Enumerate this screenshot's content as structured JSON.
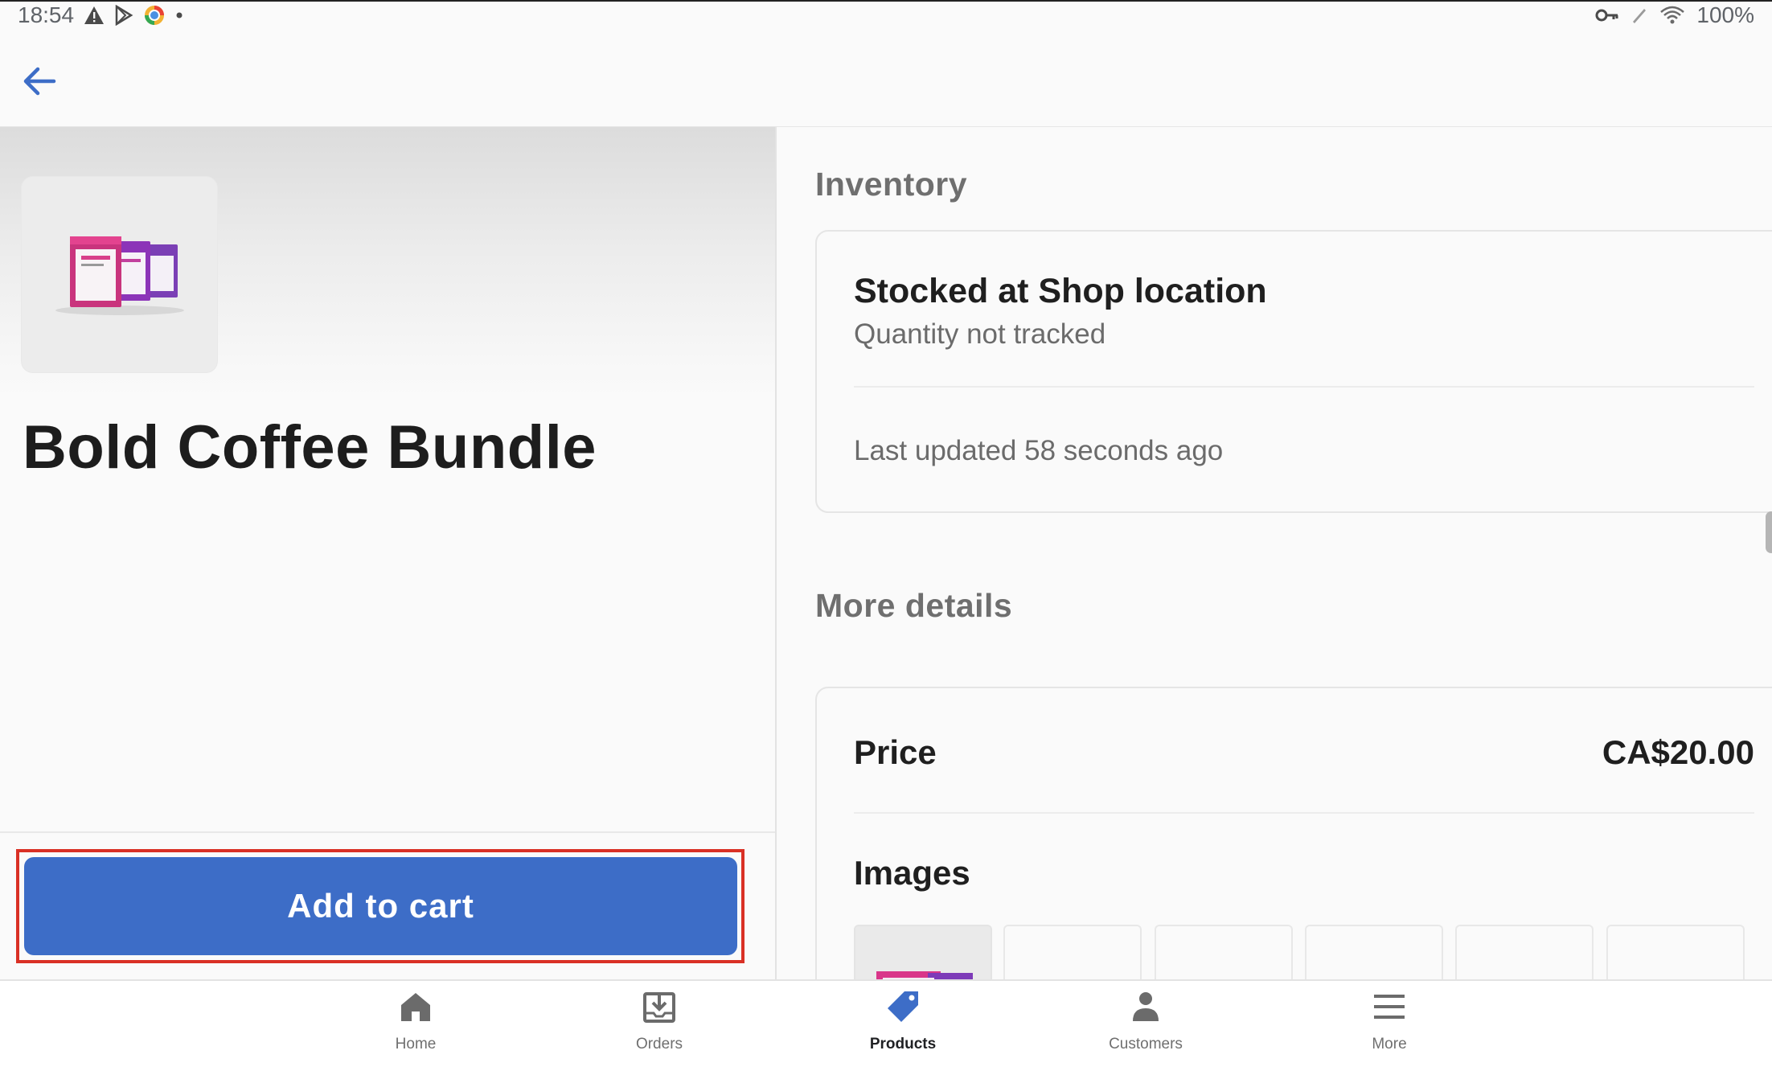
{
  "status_bar": {
    "time": "18:54",
    "battery_text": "100%",
    "left_icons": [
      "alert-icon",
      "play-store-icon",
      "browser-icon",
      "dot-icon"
    ],
    "right_icons": [
      "key-icon",
      "pen-icon",
      "wifi-icon"
    ]
  },
  "app_bar": {
    "back_icon": "arrow-left-icon",
    "accent_color": "#3d6dc7"
  },
  "product": {
    "title": "Bold Coffee Bundle",
    "thumbnail_icon": "coffee-bags-image",
    "add_to_cart_label": "Add to cart",
    "button_color": "#3d6dc7",
    "highlight_color": "#d93025"
  },
  "inventory": {
    "heading": "Inventory",
    "location_title": "Stocked at Shop location",
    "quantity_status": "Quantity not tracked",
    "last_updated": "Last updated 58 seconds ago"
  },
  "details": {
    "heading": "More details",
    "price_label": "Price",
    "price_value": "CA$20.00",
    "images_label": "Images",
    "image_slots": [
      "coffee-bag-image",
      "empty",
      "empty",
      "empty",
      "empty",
      "empty"
    ]
  },
  "bottom_nav": {
    "active": "Products",
    "active_color": "#3d6dc7",
    "items": [
      {
        "label": "Home",
        "icon": "home-icon"
      },
      {
        "label": "Orders",
        "icon": "orders-icon"
      },
      {
        "label": "Products",
        "icon": "tag-icon"
      },
      {
        "label": "Customers",
        "icon": "person-icon"
      },
      {
        "label": "More",
        "icon": "menu-icon"
      }
    ]
  }
}
